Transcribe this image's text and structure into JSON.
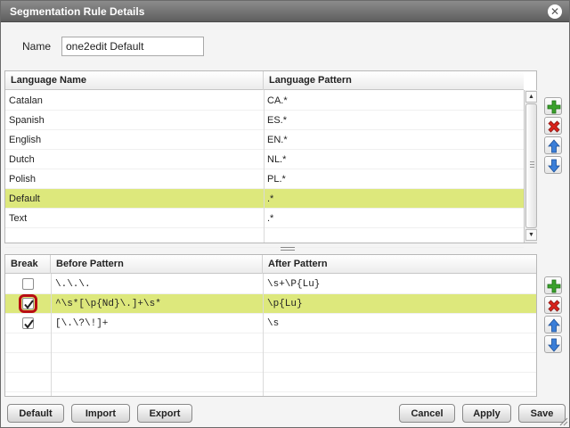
{
  "dialog": {
    "title": "Segmentation Rule Details",
    "close_icon": "close-x-icon"
  },
  "name": {
    "label": "Name",
    "value": "one2edit Default"
  },
  "languages": {
    "columns": [
      "Language Name",
      "Language Pattern"
    ],
    "rows": [
      {
        "name": "Catalan",
        "pattern": "CA.*",
        "selected": false
      },
      {
        "name": "Spanish",
        "pattern": "ES.*",
        "selected": false
      },
      {
        "name": "English",
        "pattern": "EN.*",
        "selected": false
      },
      {
        "name": "Dutch",
        "pattern": "NL.*",
        "selected": false
      },
      {
        "name": "Polish",
        "pattern": "PL.*",
        "selected": false
      },
      {
        "name": "Default",
        "pattern": ".*",
        "selected": true
      },
      {
        "name": "Text",
        "pattern": ".*",
        "selected": false
      }
    ]
  },
  "rules": {
    "columns": [
      "Break",
      "Before Pattern",
      "After Pattern"
    ],
    "rows": [
      {
        "break": false,
        "before": "\\.\\.\\.",
        "after": "\\s+\\P{Lu}",
        "selected": false
      },
      {
        "break": true,
        "before": "^\\s*[\\p{Nd}\\.]+\\s*",
        "after": "\\p{Lu}",
        "selected": true
      },
      {
        "break": true,
        "before": "[\\.\\?\\!]+",
        "after": "\\s",
        "selected": false
      }
    ]
  },
  "side_buttons": [
    "add-icon",
    "delete-icon",
    "move-up-icon",
    "move-down-icon"
  ],
  "colors": {
    "selection": "#dde87c",
    "add": "#3aa12c",
    "delete": "#d8221b",
    "arrow": "#3a7ed8",
    "highlight_ring": "#b80d12"
  },
  "footer": {
    "default_label": "Default",
    "import_label": "Import",
    "export_label": "Export",
    "cancel_label": "Cancel",
    "apply_label": "Apply",
    "save_label": "Save"
  }
}
